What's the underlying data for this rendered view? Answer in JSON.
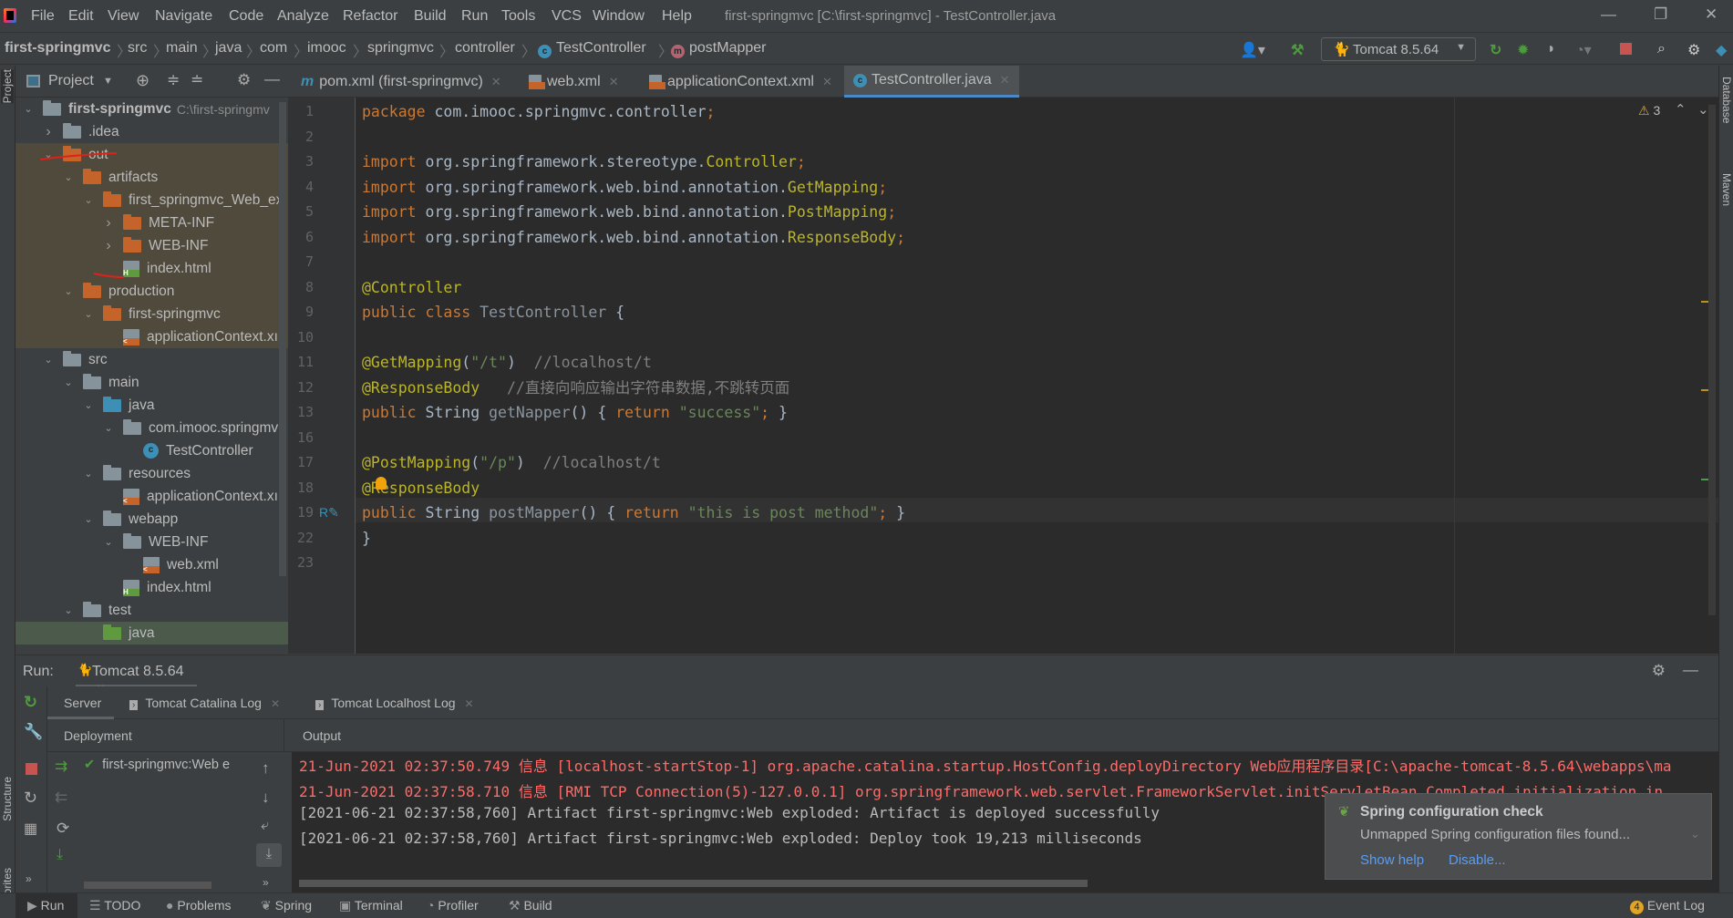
{
  "menubar": {
    "items": [
      "File",
      "Edit",
      "View",
      "Navigate",
      "Code",
      "Analyze",
      "Refactor",
      "Build",
      "Run",
      "Tools",
      "VCS",
      "Window",
      "Help"
    ],
    "window_title": "first-springmvc [C:\\first-springmvc] - TestController.java"
  },
  "breadcrumb": [
    "first-springmvc",
    "src",
    "main",
    "java",
    "com",
    "imooc",
    "springmvc",
    "controller",
    "TestController",
    "postMapper"
  ],
  "toolbar": {
    "run_config": "Tomcat 8.5.64"
  },
  "project_panel": {
    "title": "Project",
    "tree": [
      {
        "level": 0,
        "chev": "v",
        "icon": "folder-gray",
        "label": "first-springmvc",
        "hint": "C:\\first-springmv",
        "bold": true
      },
      {
        "level": 1,
        "chev": ">",
        "icon": "folder-gray",
        "label": ".idea"
      },
      {
        "level": 1,
        "chev": "v",
        "icon": "folder-orange",
        "label": "out",
        "excluded": true
      },
      {
        "level": 2,
        "chev": "v",
        "icon": "folder-orange",
        "label": "artifacts",
        "excluded": true
      },
      {
        "level": 3,
        "chev": "v",
        "icon": "folder-orange",
        "label": "first_springmvc_Web_ex",
        "excluded": true
      },
      {
        "level": 4,
        "chev": ">",
        "icon": "folder-orange",
        "label": "META-INF",
        "excluded": true
      },
      {
        "level": 4,
        "chev": ">",
        "icon": "folder-orange",
        "label": "WEB-INF",
        "excluded": true
      },
      {
        "level": 4,
        "chev": "",
        "icon": "file-html",
        "label": "index.html",
        "excluded": true
      },
      {
        "level": 2,
        "chev": "v",
        "icon": "folder-orange",
        "label": "production",
        "excluded": true
      },
      {
        "level": 3,
        "chev": "v",
        "icon": "folder-orange",
        "label": "first-springmvc",
        "excluded": true
      },
      {
        "level": 4,
        "chev": "",
        "icon": "file-xml",
        "label": "applicationContext.xı",
        "excluded": true
      },
      {
        "level": 1,
        "chev": "v",
        "icon": "folder-gray",
        "label": "src"
      },
      {
        "level": 2,
        "chev": "v",
        "icon": "folder-gray",
        "label": "main"
      },
      {
        "level": 3,
        "chev": "v",
        "icon": "folder-blue",
        "label": "java"
      },
      {
        "level": 4,
        "chev": "v",
        "icon": "folder-gray",
        "label": "com.imooc.springmv"
      },
      {
        "level": 5,
        "chev": "",
        "icon": "class",
        "label": "TestController"
      },
      {
        "level": 3,
        "chev": "v",
        "icon": "folder-gray",
        "label": "resources"
      },
      {
        "level": 4,
        "chev": "",
        "icon": "file-xml",
        "label": "applicationContext.xı"
      },
      {
        "level": 3,
        "chev": "v",
        "icon": "folder-gray",
        "label": "webapp"
      },
      {
        "level": 4,
        "chev": "v",
        "icon": "folder-gray",
        "label": "WEB-INF"
      },
      {
        "level": 5,
        "chev": "",
        "icon": "file-xml",
        "label": "web.xml"
      },
      {
        "level": 4,
        "chev": "",
        "icon": "file-html",
        "label": "index.html"
      },
      {
        "level": 2,
        "chev": "v",
        "icon": "folder-gray",
        "label": "test"
      },
      {
        "level": 3,
        "chev": "",
        "icon": "folder-green",
        "label": "java",
        "selected": true
      }
    ]
  },
  "editor_tabs": [
    {
      "label": "pom.xml (first-springmvc)",
      "icon": "maven-icon"
    },
    {
      "label": "web.xml",
      "icon": "xml-file-icon"
    },
    {
      "label": "applicationContext.xml",
      "icon": "spring-xml-icon"
    },
    {
      "label": "TestController.java",
      "icon": "class-icon",
      "active": true
    }
  ],
  "editor": {
    "warnings": "3",
    "lines": [
      {
        "n": "1",
        "t": [
          [
            "package ",
            "kw"
          ],
          [
            "com.imooc.springmvc.controller",
            "pl"
          ],
          [
            ";",
            "kw"
          ]
        ]
      },
      {
        "n": "2",
        "t": []
      },
      {
        "n": "3",
        "t": [
          [
            "import ",
            "kw"
          ],
          [
            "org.springframework.stereotype.",
            "pl"
          ],
          [
            "Controller",
            "imp"
          ],
          [
            ";",
            "kw"
          ]
        ]
      },
      {
        "n": "4",
        "t": [
          [
            "import ",
            "kw"
          ],
          [
            "org.springframework.web.bind.annotation.",
            "pl"
          ],
          [
            "GetMapping",
            "imp"
          ],
          [
            ";",
            "kw"
          ]
        ]
      },
      {
        "n": "5",
        "t": [
          [
            "import ",
            "kw"
          ],
          [
            "org.springframework.web.bind.annotation.",
            "pl"
          ],
          [
            "PostMapping",
            "imp"
          ],
          [
            ";",
            "kw"
          ]
        ]
      },
      {
        "n": "6",
        "t": [
          [
            "import ",
            "kw"
          ],
          [
            "org.springframework.web.bind.annotation.",
            "pl"
          ],
          [
            "ResponseBody",
            "imp"
          ],
          [
            ";",
            "kw"
          ]
        ]
      },
      {
        "n": "7",
        "t": []
      },
      {
        "n": "8",
        "t": [
          [
            "@Controller",
            "ann"
          ]
        ]
      },
      {
        "n": "9",
        "t": [
          [
            "public class ",
            "kw"
          ],
          [
            "TestController ",
            "fn"
          ],
          [
            "{",
            "pl"
          ]
        ]
      },
      {
        "n": "10",
        "t": []
      },
      {
        "n": "11",
        "t": [
          [
            "@GetMapping",
            "ann"
          ],
          [
            "(",
            "pl"
          ],
          [
            "\"/t\"",
            "str"
          ],
          [
            ")  ",
            "pl"
          ],
          [
            "//localhost/t",
            "cmt"
          ]
        ]
      },
      {
        "n": "12",
        "t": [
          [
            "@ResponseBody",
            "ann"
          ],
          [
            "   ",
            "pl"
          ],
          [
            "//直接向响应输出字符串数据,不跳转页面",
            "cmt"
          ]
        ]
      },
      {
        "n": "13",
        "t": [
          [
            "public ",
            "kw"
          ],
          [
            "String ",
            "pl"
          ],
          [
            "getNapper",
            "fn"
          ],
          [
            "() ",
            "pl"
          ],
          [
            "{ ",
            "pl"
          ],
          [
            "return ",
            "kw"
          ],
          [
            "\"success\"",
            "str"
          ],
          [
            ";",
            "kw"
          ],
          [
            " }",
            "pl"
          ]
        ]
      },
      {
        "n": "16",
        "t": []
      },
      {
        "n": "17",
        "t": [
          [
            "@PostMapping",
            "ann"
          ],
          [
            "(",
            "pl"
          ],
          [
            "\"/p\"",
            "str"
          ],
          [
            ")  ",
            "pl"
          ],
          [
            "//localhost/t",
            "cmt"
          ]
        ]
      },
      {
        "n": "18",
        "t": [
          [
            "@ResponseBody",
            "ann"
          ]
        ]
      },
      {
        "n": "19",
        "t": [
          [
            "public ",
            "kw"
          ],
          [
            "String ",
            "pl"
          ],
          [
            "postMapper",
            "fn"
          ],
          [
            "() ",
            "pl"
          ],
          [
            "{ ",
            "pl"
          ],
          [
            "return ",
            "kw"
          ],
          [
            "\"this is post method\"",
            "str"
          ],
          [
            ";",
            "kw"
          ],
          [
            " }",
            "pl"
          ]
        ]
      },
      {
        "n": "22",
        "t": [
          [
            "}",
            "pl"
          ]
        ]
      },
      {
        "n": "23",
        "t": []
      }
    ]
  },
  "run_panel": {
    "label": "Run:",
    "tab": "Tomcat 8.5.64",
    "subtabs": [
      "Server",
      "Tomcat Catalina Log",
      "Tomcat Localhost Log"
    ],
    "deployment_header": "Deployment",
    "output_header": "Output",
    "deployment_item": "first-springmvc:Web e",
    "log": [
      {
        "text": "21-Jun-2021 02:37:50.749 信息 [localhost-startStop-1] org.apache.catalina.startup.HostConfig.deployDirectory Web应用程序目录[C:\\apache-tomcat-8.5.64\\webapps\\ma",
        "level": "info-red"
      },
      {
        "text": "21-Jun-2021 02:37:58.710 信息 [RMI TCP Connection(5)-127.0.0.1] org.springframework.web.servlet.FrameworkServlet.initServletBean Completed initialization in",
        "level": "info-red"
      },
      {
        "text": "[2021-06-21 02:37:58,760] Artifact first-springmvc:Web exploded: Artifact is deployed successfully",
        "level": "normal"
      },
      {
        "text": "[2021-06-21 02:37:58,760] Artifact first-springmvc:Web exploded: Deploy took 19,213 milliseconds",
        "level": "normal"
      }
    ]
  },
  "notification": {
    "title": "Spring configuration check",
    "body": "Unmapped Spring configuration files found...",
    "actions": [
      "Show help",
      "Disable..."
    ]
  },
  "side_labels": {
    "left_top": "Project",
    "left_structure": "Structure",
    "left_favorites": "Favorites",
    "right_database": "Database",
    "right_maven": "Maven"
  },
  "bottom_tools": [
    "Run",
    "TODO",
    "Problems",
    "Spring",
    "Terminal",
    "Profiler",
    "Build"
  ],
  "event_log": {
    "count": "4",
    "label": "Event Log"
  },
  "colors": {
    "accent": "#4A88C7",
    "keyword": "#CC7832",
    "annotation": "#BBB529",
    "string": "#6A8759",
    "log_red": "#FF6B68",
    "excluded_bg": "#4F4A3C",
    "selected_bg": "#4B5A4B"
  }
}
